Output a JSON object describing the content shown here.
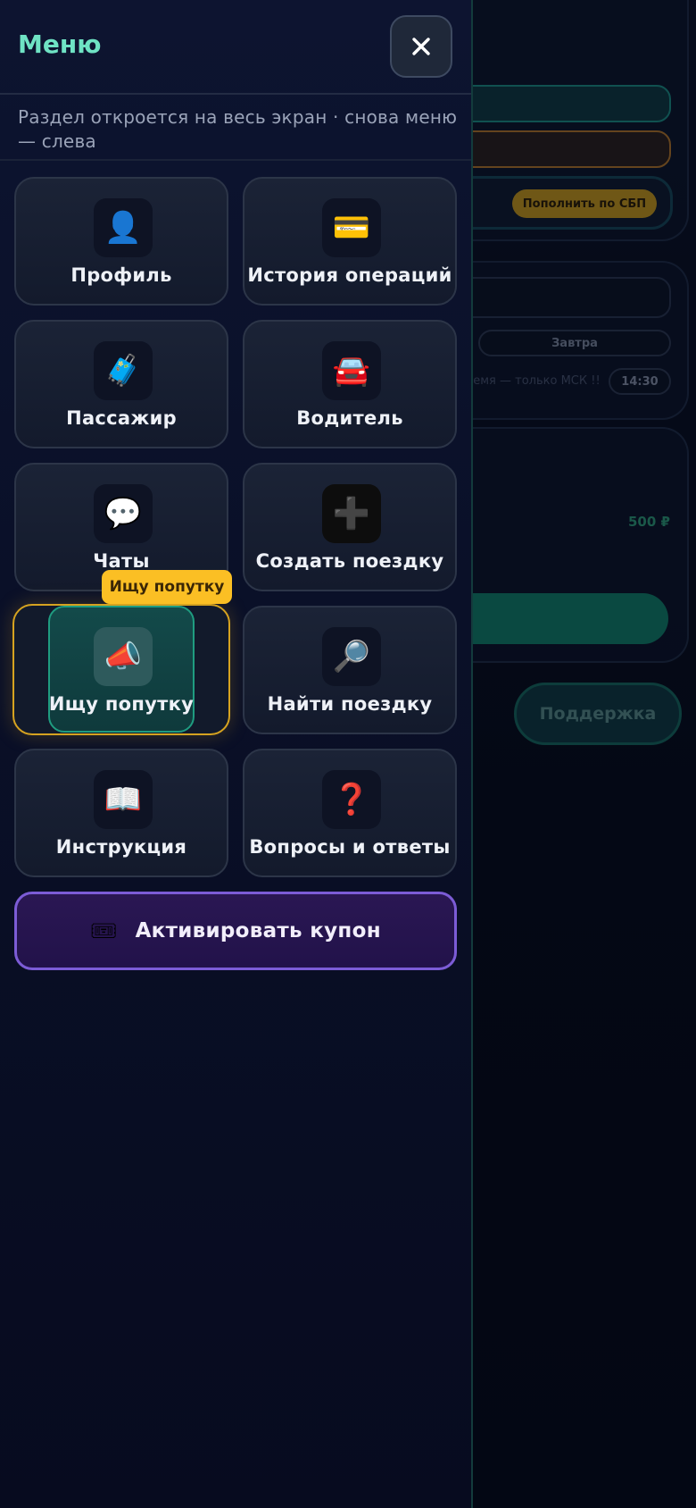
{
  "drawer": {
    "title": "Меню",
    "close_icon": "close-icon",
    "hint": "Раздел откроется на весь экран · снова меню — слева",
    "tiles": [
      {
        "label": "Профиль",
        "icon": "👤",
        "icon_name": "profile-icon"
      },
      {
        "label": "История операций",
        "icon": "💳",
        "icon_name": "credit-card-icon"
      },
      {
        "label": "Пассажир",
        "icon": "🧳",
        "icon_name": "luggage-icon"
      },
      {
        "label": "Водитель",
        "icon": "🚘",
        "icon_name": "car-icon"
      },
      {
        "label": "Чаты",
        "icon": "💬",
        "icon_name": "chat-bubble-icon"
      },
      {
        "label": "Создать поездку",
        "icon": "➕",
        "icon_name": "plus-icon"
      },
      {
        "label": "Ищу попутку",
        "icon": "📣",
        "icon_name": "megaphone-icon"
      },
      {
        "label": "Найти поездку",
        "icon": "🔎",
        "icon_name": "search-icon"
      },
      {
        "label": "Инструкция",
        "icon": "📖",
        "icon_name": "book-icon"
      },
      {
        "label": "Вопросы и ответы",
        "icon": "❓",
        "icon_name": "question-icon"
      }
    ],
    "active_tile_tooltip": "Ищу попутку",
    "coupon": {
      "label": "Активировать купон",
      "icon": "🎟",
      "icon_name": "ticket-icon"
    }
  },
  "background": {
    "topup_button": "Пополнить по СБП",
    "day_option": "Завтра",
    "time_note": "ремя — только МСК !!!",
    "time_value": "14:30",
    "price": "500 ₽",
    "support_button": "Поддержка"
  },
  "colors": {
    "accent_teal": "#6fe3c4",
    "highlight_gold": "#fbbf24",
    "coupon_purple": "#7c5cd6"
  }
}
